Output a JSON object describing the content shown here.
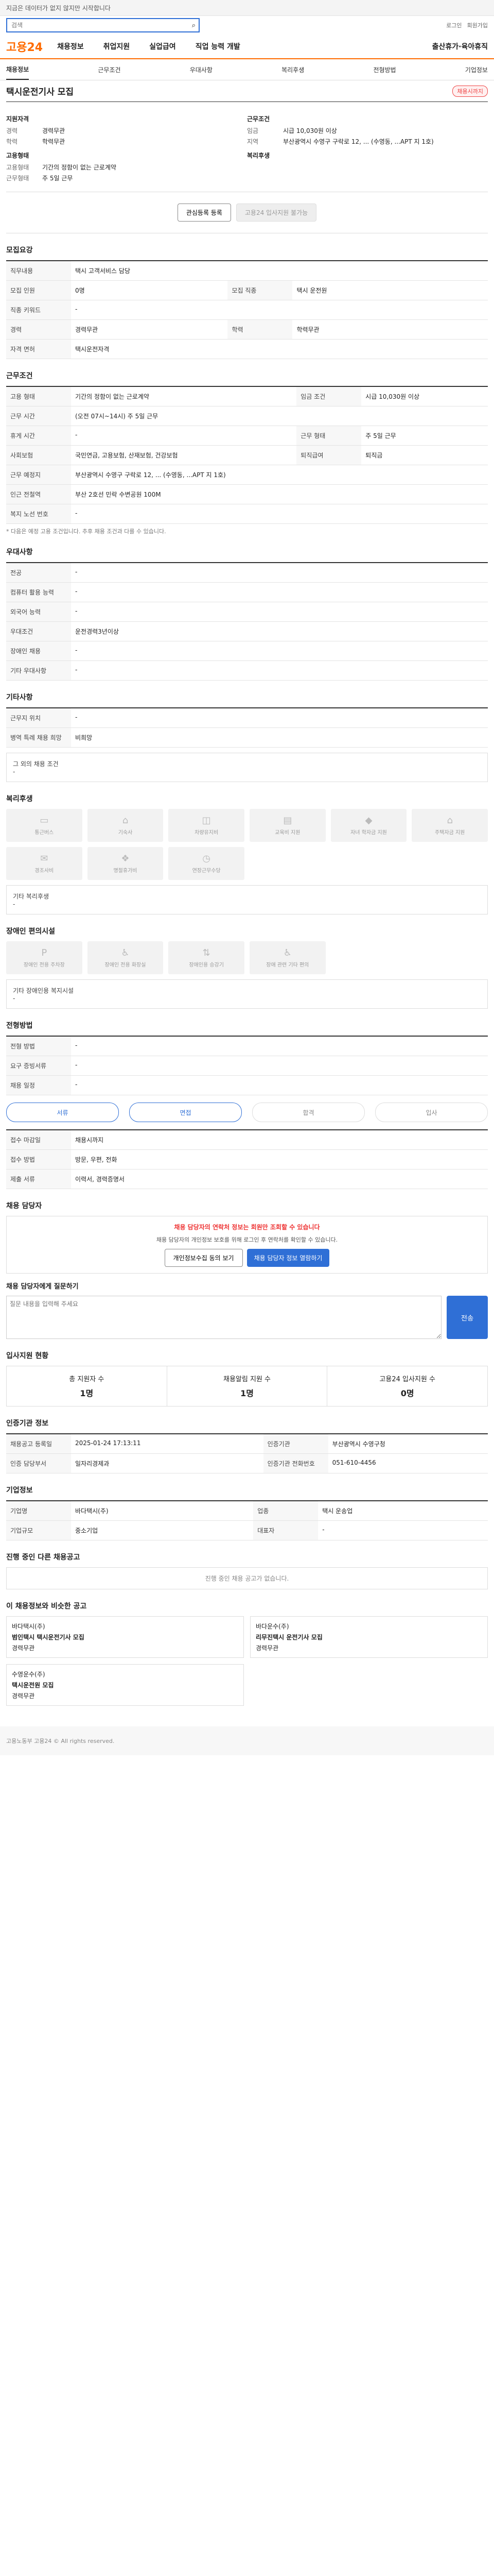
{
  "topbar": {
    "notice": "지금은 데이터가 없지 않지만 시작합니다"
  },
  "search": {
    "placeholder": "검색"
  },
  "util": [
    "로그인",
    "회원가입"
  ],
  "brand": {
    "name": "고용24"
  },
  "gnb": [
    "채용정보",
    "취업지원",
    "실업급여",
    "직업 능력 개발",
    "출산휴가·육아휴직"
  ],
  "subnav": [
    "채용정보",
    "근무조건",
    "우대사항",
    "복리후생",
    "전형방법",
    "기업정보"
  ],
  "job": {
    "title": "택시운전기사 모집",
    "badge": "채용시까지",
    "summary": {
      "left_head": "지원자격",
      "left": [
        {
          "k": "경력",
          "v": "경력무관"
        },
        {
          "k": "학력",
          "v": "학력무관"
        }
      ],
      "left_head2": "고용형태",
      "left2": [
        {
          "k": "고용형태",
          "v": "기간의 정함이 없는 근로계약"
        },
        {
          "k": "근무형태",
          "v": "주 5일 근무"
        }
      ],
      "right_head": "근무조건",
      "right": [
        {
          "k": "임금",
          "v": "시급 10,030원 이상"
        },
        {
          "k": "지역",
          "v": "부산광역시 수영구 구락로 12, ... (수영동, ...APT 지 1호)"
        }
      ],
      "right_head2": "복리후생"
    },
    "actions": {
      "scrap": "관심등록 등록",
      "apply": "고용24 입사지원 불가능"
    }
  },
  "sections": {
    "recruit": "모집요강",
    "recruit_rows": [
      {
        "k": "직무내용",
        "v": "택시 고객서비스 담당"
      },
      {
        "k": "모집 인원",
        "v": "0명"
      },
      {
        "k": "모집 직종",
        "v": "택시 운전원"
      },
      {
        "k": "직종 키워드",
        "v": "-"
      },
      {
        "k": "경력",
        "v": "경력무관"
      },
      {
        "k": "학력",
        "v": "학력무관"
      },
      {
        "k": "자격 면허",
        "v": "택시운전자격"
      }
    ],
    "work": "근무조건",
    "work_rows": [
      {
        "k": "고용 형태",
        "v": "기간의 정함이 없는 근로계약"
      },
      {
        "k": "임금 조건",
        "v": "시급 10,030원 이상"
      },
      {
        "k": "근무 시간",
        "v": "(오전 07시~14시) 주 5일 근무"
      },
      {
        "k": "휴게 시간",
        "v": "-"
      },
      {
        "k": "근무 형태",
        "v": "주 5일 근무"
      },
      {
        "k": "사회보험",
        "v": "국민연금, 고용보험, 산재보험, 건강보험"
      },
      {
        "k": "퇴직급여",
        "v": "퇴직금"
      },
      {
        "k": "근무 예정지",
        "v": "부산광역시 수영구 구락로 12, ... (수영동, ...APT 지 1호)"
      },
      {
        "k": "인근 전철역",
        "v": "부산 2호선 민락 수변공원 100M"
      },
      {
        "k": "복지 노선 번호",
        "v": "-"
      }
    ],
    "work_note": "* 다음은 예정 고용 조건입니다. 추후 채용 조건과 다를 수 있습니다.",
    "prefer": "우대사항",
    "prefer_rows": [
      {
        "k": "전공",
        "v": "-"
      },
      {
        "k": "컴퓨터 활용 능력",
        "v": "-"
      },
      {
        "k": "외국어 능력",
        "v": "-"
      },
      {
        "k": "우대조건",
        "v": "운전경력3년이상"
      },
      {
        "k": "장애인 채용",
        "v": "-"
      },
      {
        "k": "기타 우대사항",
        "v": "-"
      }
    ],
    "etc": "기타사항",
    "etc_rows": [
      {
        "k": "근무지 위치",
        "v": "-"
      },
      {
        "k": "병역 특례 채용 희망",
        "v": "비희망"
      }
    ],
    "other_conditions": "그 외의 채용 조건",
    "other_value": "-",
    "benefit": "복리후생",
    "benefit_icons": [
      "통근버스",
      "기숙사",
      "차량유지비",
      "교육비 지원",
      "자녀 학자금 지원",
      "주택자금 지원",
      "경조사비",
      "명절휴가비",
      "연장근무수당"
    ],
    "benefit_extra_label": "기타 복리후생",
    "benefit_extra": "-",
    "disabled": "장애인 편의시설",
    "disabled_icons": [
      "장애인 전용 주차장",
      "장애인 전용 화장실",
      "장애인용 승강기",
      "장애 관련 기타 편의"
    ],
    "disabled_extra_label": "기타 장애인용 복지시설",
    "disabled_extra": "-",
    "jobproc": "전형방법",
    "jobproc_rows": [
      {
        "k": "전형 방법",
        "v": "-"
      },
      {
        "k": "요구 증빙서류",
        "v": "-"
      },
      {
        "k": "채용 일정",
        "v": "-"
      }
    ],
    "steps": [
      "서류",
      "면접",
      "합격",
      "입사"
    ],
    "apply_rows": [
      {
        "k": "접수 마감일",
        "v": "채용시까지"
      },
      {
        "k": "접수 방법",
        "v": "방문, 우편, 전화"
      },
      {
        "k": "제출 서류",
        "v": "이력서, 경력증명서"
      }
    ],
    "contact": "채용 담당자",
    "contact_alert": "채용 담당자의 연락처 정보는 회원만 조회할 수 있습니다",
    "contact_desc": "채용 담당자의 개인정보 보호를 위해 로그인 후 연락처를 확인할 수 있습니다.",
    "contact_btn1": "개인정보수집 동의 보기",
    "contact_btn2": "채용 담당자 정보 열람하기",
    "qa": "채용 담당자에게 질문하기",
    "qa_placeholder": "질문 내용을 입력해 주세요",
    "qa_btn": "전송",
    "stats_title": "입사지원 현황",
    "stats": [
      {
        "k": "총 지원자 수",
        "v": "1명"
      },
      {
        "k": "채용알림 지원 수",
        "v": "1명"
      },
      {
        "k": "고용24 입사지원 수",
        "v": "0명"
      }
    ],
    "info_title": "인증기관 정보",
    "info_rows": [
      {
        "k": "채용공고 등록일",
        "v": "2025-01-24 17:13:11"
      },
      {
        "k": "인증기관",
        "v": "부산광역시 수영구청"
      },
      {
        "k": "인증 담당부서",
        "v": "일자리경제과"
      },
      {
        "k": "인증기관 전화번호",
        "v": "051-610-4456"
      }
    ],
    "company_title": "기업정보",
    "company_rows": [
      {
        "k": "기업명",
        "v": "바다택시(주)"
      },
      {
        "k": "업종",
        "v": "택시 운송업"
      },
      {
        "k": "기업규모",
        "v": "중소기업"
      },
      {
        "k": "대표자",
        "v": "-"
      }
    ],
    "other_jobs_title": "진행 중인 다른 채용공고",
    "other_jobs_empty": "진행 중인 채용 공고가 없습니다.",
    "rec_title": "이 채용정보와 비슷한 공고",
    "recs": [
      {
        "org": "바다택시(주)",
        "title": "범인택시 택시운전기사 모집",
        "tag": "경력무관"
      },
      {
        "org": "바다운수(주)",
        "title": "리무진택시 운전기사 모집",
        "tag": "경력무관"
      },
      {
        "org": "수영운수(주)",
        "title": "택시운전원 모집",
        "tag": "경력무관"
      }
    ]
  },
  "footer": "고용노동부 고용24 © All rights reserved."
}
